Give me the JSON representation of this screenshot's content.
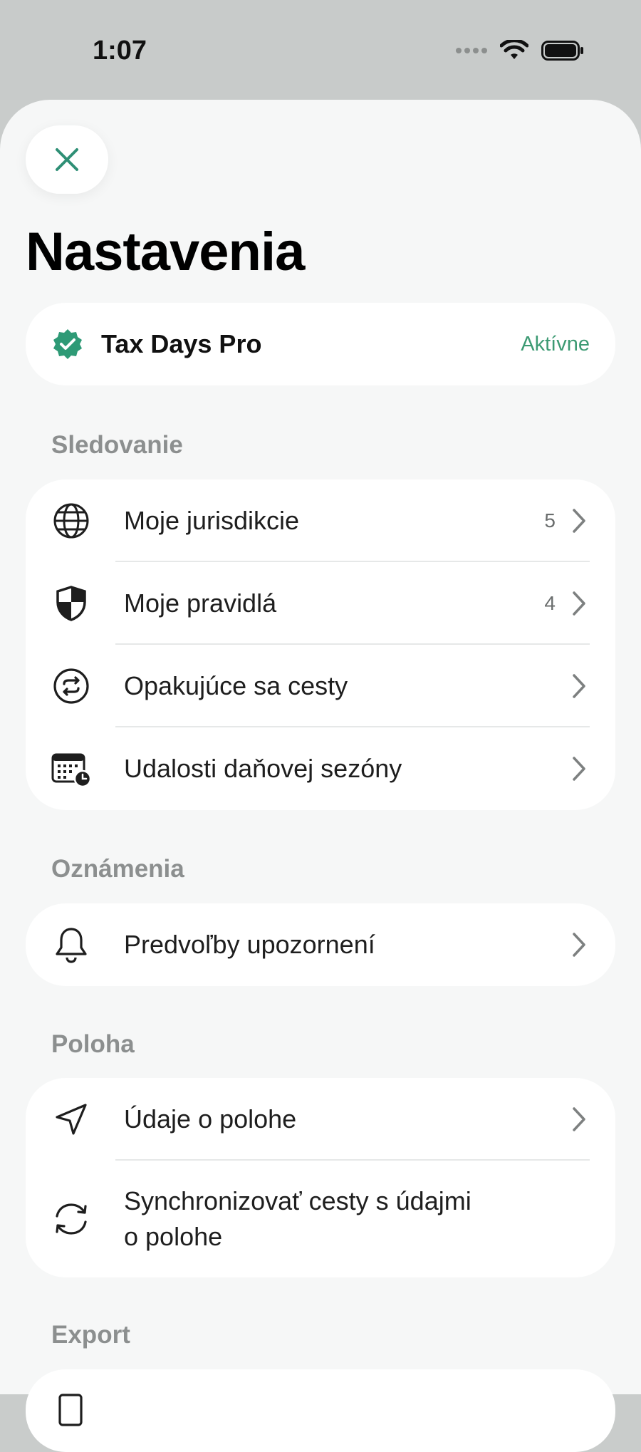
{
  "status_bar": {
    "time": "1:07"
  },
  "header": {
    "title": "Nastavenia"
  },
  "pro": {
    "name": "Tax Days Pro",
    "status": "Aktívne",
    "accent": "#2e9a76"
  },
  "sections": {
    "tracking": {
      "title": "Sledovanie",
      "items": [
        {
          "label": "Moje jurisdikcie",
          "count": "5",
          "icon": "globe-icon"
        },
        {
          "label": "Moje pravidlá",
          "count": "4",
          "icon": "shield-icon"
        },
        {
          "label": "Opakujúce sa cesty",
          "icon": "repeat-icon"
        },
        {
          "label": "Udalosti daňovej sezóny",
          "icon": "calendar-clock-icon"
        }
      ]
    },
    "notifications": {
      "title": "Oznámenia",
      "items": [
        {
          "label": "Predvoľby upozornení",
          "icon": "bell-icon"
        }
      ]
    },
    "location": {
      "title": "Poloha",
      "items": [
        {
          "label": "Údaje o polohe",
          "icon": "location-arrow-icon"
        },
        {
          "label_line1": "Synchronizovať cesty s údajmi",
          "label_line2": "o polohe",
          "icon": "sync-icon"
        }
      ]
    },
    "export": {
      "title": "Export"
    }
  }
}
